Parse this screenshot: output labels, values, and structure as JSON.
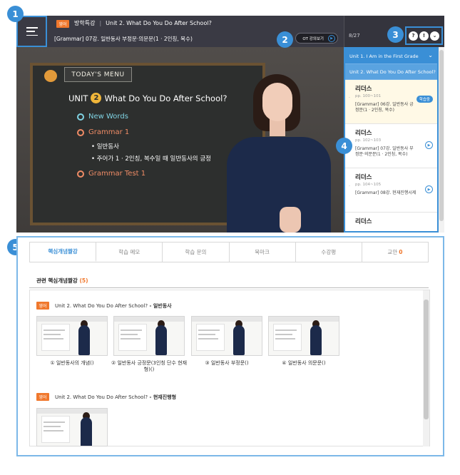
{
  "header": {
    "subject_badge": "영어",
    "course": "방학특강",
    "separator": "|",
    "unit": "Unit 2. What Do You Do After School?",
    "lecture": "[Grammar] 07강. 일반동사 부정문·의문문(1 · 2인칭, 복수)",
    "ot_button": "OT 강의보기",
    "progress": "8/27",
    "controls": [
      "?",
      "!",
      "⌄"
    ]
  },
  "video": {
    "menu_tag": "TODAY'S MENU",
    "unit_prefix": "UNIT",
    "unit_number": "2",
    "unit_title": "What Do You Do After School?",
    "items": [
      {
        "label": "New Words",
        "color": "#7fd3e3"
      },
      {
        "label": "Grammar 1",
        "color": "#f08c66"
      },
      {
        "label": "Grammar Test 1",
        "color": "#f08c66"
      }
    ],
    "sub_items": [
      "•  일반동사",
      "•  주어가 1 · 2인칭, 복수일 때 일반동사의 긍정"
    ]
  },
  "sidebar": {
    "units": [
      {
        "label": "Unit 1. I Am in the First Grade",
        "chevron": "⌄"
      },
      {
        "label": "Unit 2. What Do You Do After School?"
      }
    ],
    "lessons": [
      {
        "title": "리더스",
        "pages": "pp. 100~101",
        "desc": "[Grammar] 06강. 일반동사 긍정문(1 · 2인칭, 복수)",
        "action": "학습중",
        "active": true
      },
      {
        "title": "리더스",
        "pages": "pp. 102~103",
        "desc": "[Grammar] 07강. 일반동사 부정문·의문문(1 · 2인칭, 복수)",
        "action": "▶",
        "active": false
      },
      {
        "title": "리더스",
        "pages": "pp. 104~105",
        "desc": "[Grammar] 08강. 현재진행시제",
        "action": "▶",
        "active": false
      },
      {
        "title": "리더스",
        "pages": "",
        "desc": "",
        "action": "",
        "active": false
      }
    ]
  },
  "callouts": [
    "1",
    "2",
    "3",
    "4",
    "5"
  ],
  "tabs": [
    {
      "label": "핵심개념짤강",
      "active": true
    },
    {
      "label": "학습 메모"
    },
    {
      "label": "학습 문의"
    },
    {
      "label": "북마크"
    },
    {
      "label": "수강평"
    },
    {
      "label": "교안",
      "count": "0"
    }
  ],
  "related": {
    "title": "관련 핵심개념짤강",
    "count": "(5)",
    "groups": [
      {
        "badge": "영어",
        "unit": "Unit 2. What Do You Do After School?",
        "topic": " - 일반동사",
        "videos": [
          "① 일반동사의 개념()",
          "② 일반동사 긍정문(3인칭 단수 현재형)()",
          "③ 일반동사 부정문()",
          "④ 일반동사 의문문()"
        ]
      },
      {
        "badge": "영어",
        "unit": "Unit 2. What Do You Do After School?",
        "topic": " - 현재진행형",
        "videos": [
          ""
        ]
      }
    ]
  }
}
